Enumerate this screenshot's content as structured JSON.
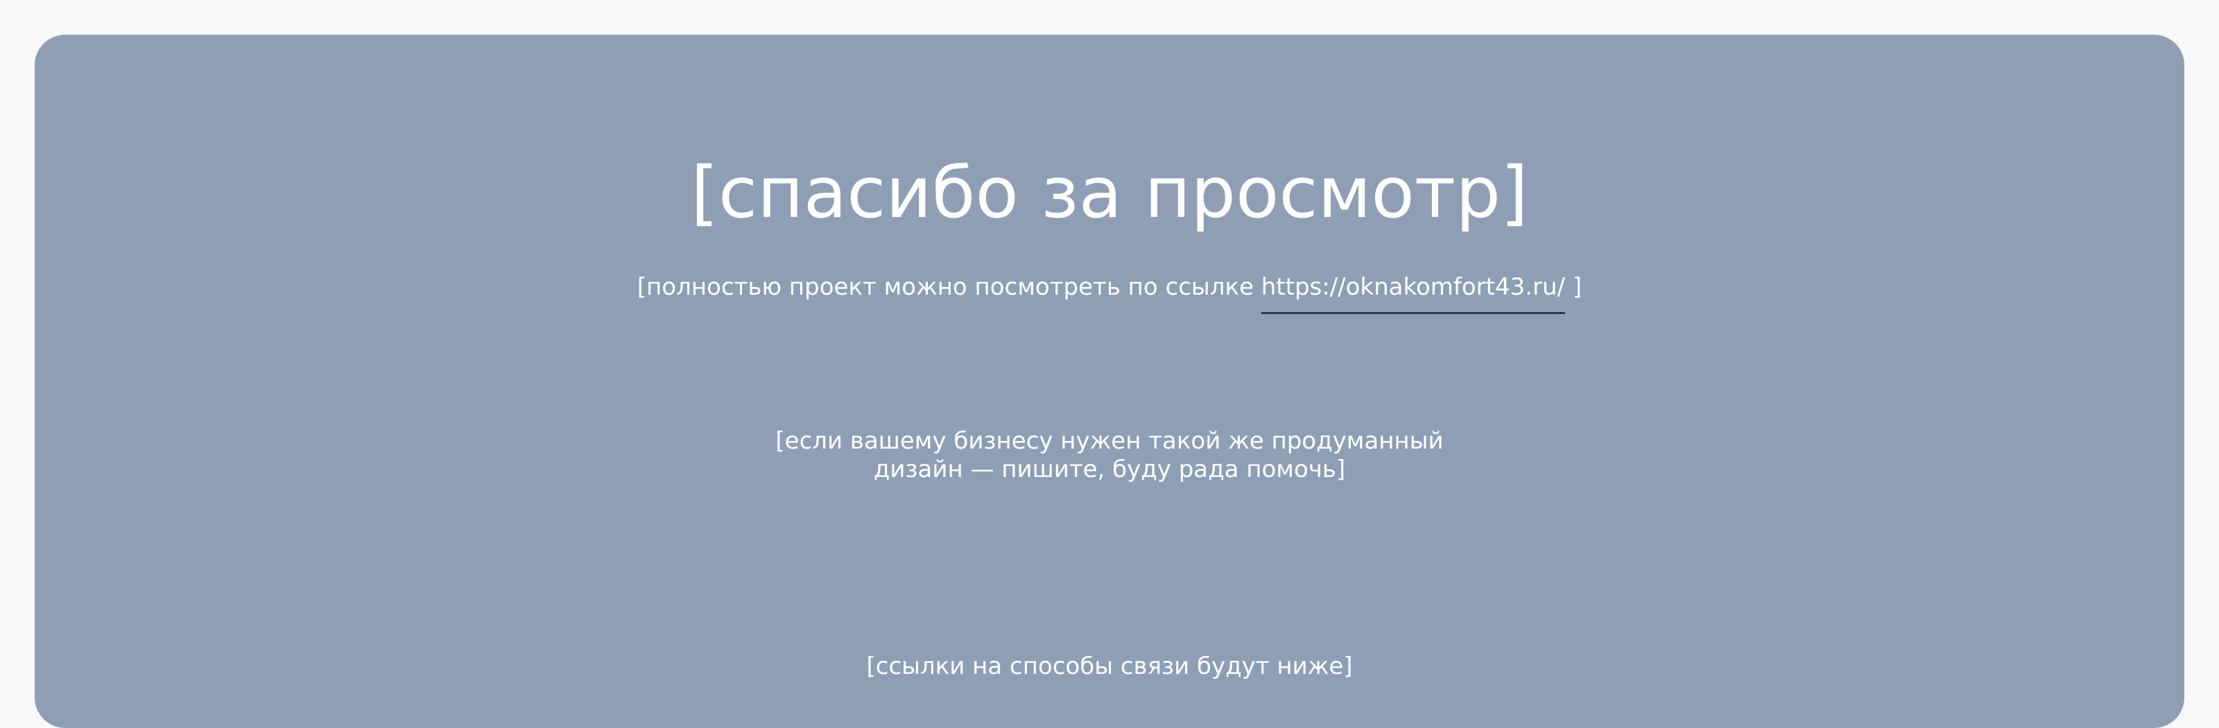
{
  "page": {
    "background": "#f8f8f9",
    "card_color": "#8e9eb5",
    "text_color": "#ffffff",
    "link_underline_color": "#253a64"
  },
  "thanks": {
    "title": "[спасибо за просмотр]",
    "project_text": "[полностью проект можно посмотреть по ссылке ",
    "project_link": "https://oknakomfort43.ru/",
    "project_close": " ]"
  },
  "offer": {
    "line1": "[если вашему бизнесу нужен такой же продуманный",
    "line2": "дизайн — пишите, буду рада помочь]"
  },
  "contacts": {
    "text": "[ссылки на способы связи будут ниже]"
  }
}
